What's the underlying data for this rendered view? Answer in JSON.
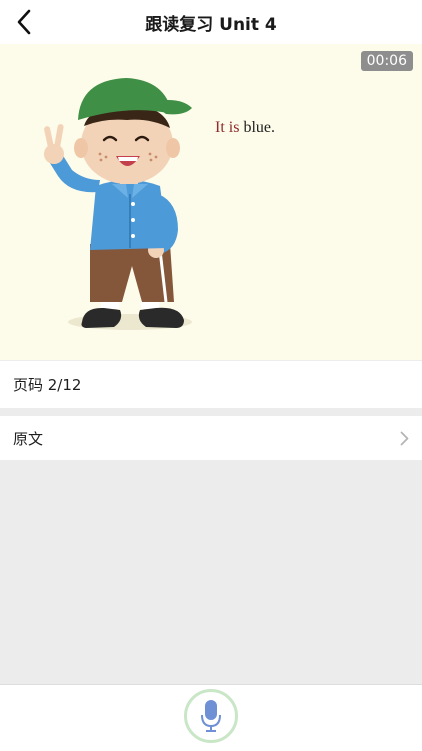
{
  "header": {
    "title": "跟读复习 Unit 4",
    "back_icon": "chevron-left-icon"
  },
  "lesson": {
    "timer": "00:06",
    "caption_highlight": "It is",
    "caption_rest": " blue."
  },
  "page_indicator": {
    "label": "页码 2/12"
  },
  "original_text_row": {
    "label": "原文",
    "icon": "chevron-right-icon"
  },
  "footer": {
    "record_icon": "microphone-icon",
    "accent_color": "#c9e6c7"
  }
}
